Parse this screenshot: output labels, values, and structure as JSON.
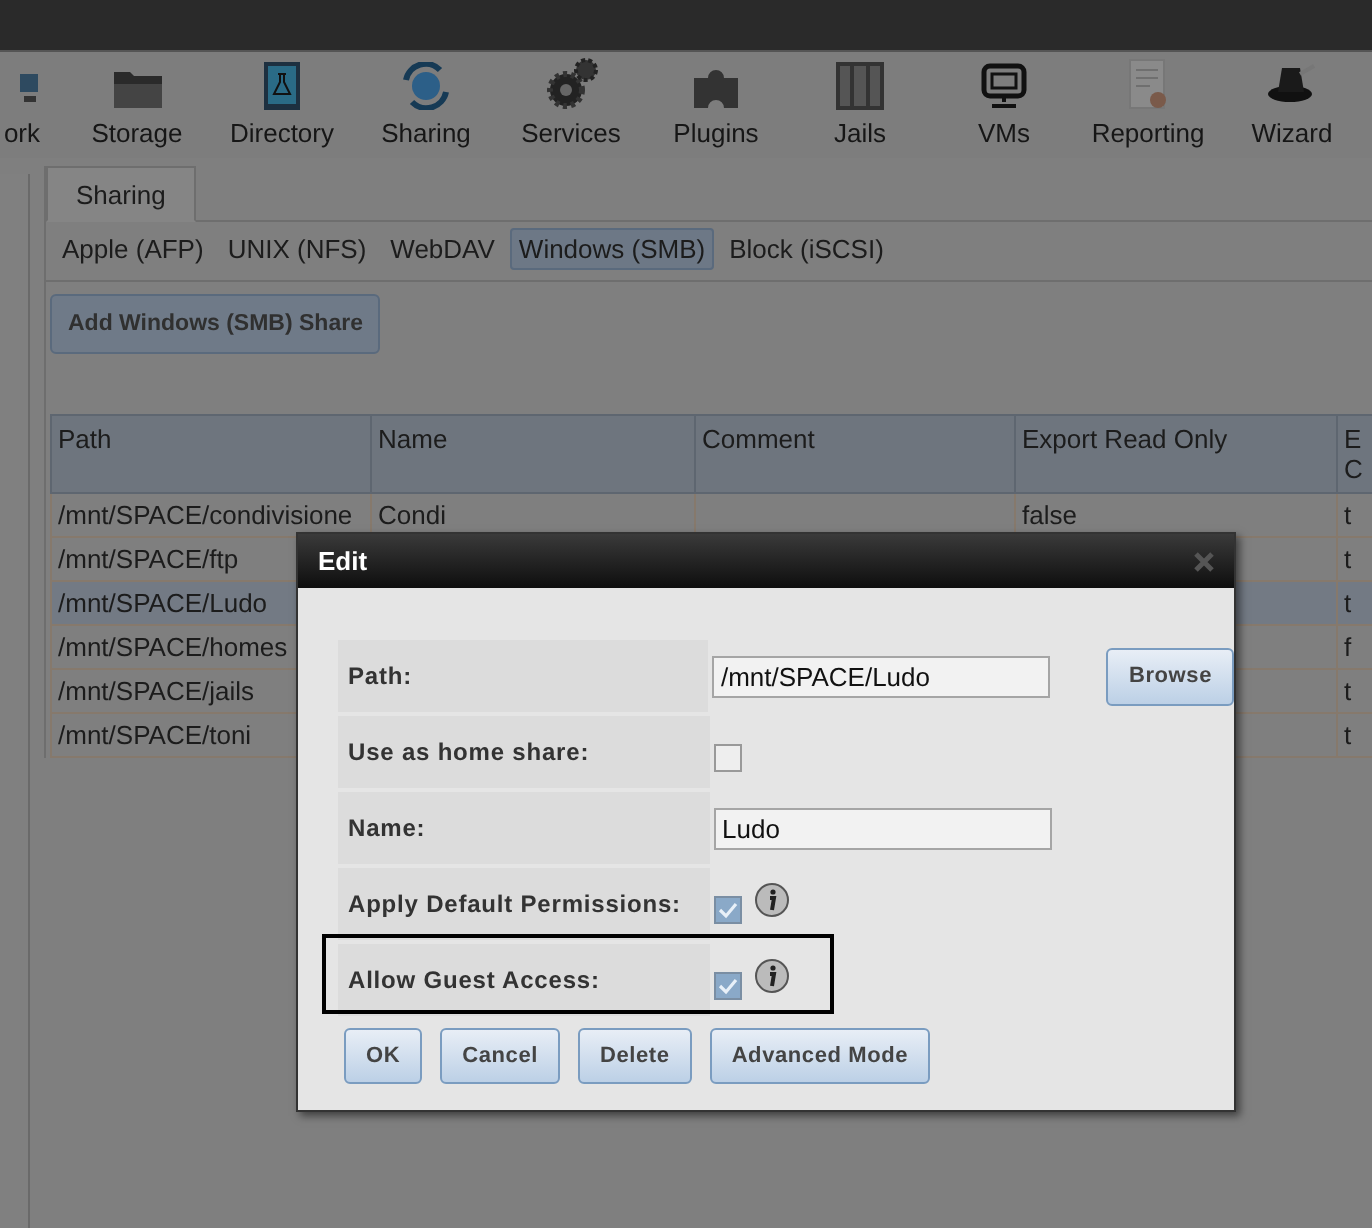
{
  "nav": [
    {
      "label": "ork",
      "kind": "network"
    },
    {
      "label": "Storage",
      "kind": "folder"
    },
    {
      "label": "Directory",
      "kind": "book"
    },
    {
      "label": "Sharing",
      "kind": "globe"
    },
    {
      "label": "Services",
      "kind": "gears"
    },
    {
      "label": "Plugins",
      "kind": "puzzle"
    },
    {
      "label": "Jails",
      "kind": "bars"
    },
    {
      "label": "VMs",
      "kind": "monitor"
    },
    {
      "label": "Reporting",
      "kind": "report"
    },
    {
      "label": "Wizard",
      "kind": "hat"
    }
  ],
  "page_tabs": [
    {
      "label": "Sharing",
      "selected": true
    }
  ],
  "share_types": [
    {
      "label": "Apple (AFP)",
      "selected": false
    },
    {
      "label": "UNIX (NFS)",
      "selected": false
    },
    {
      "label": "WebDAV",
      "selected": false
    },
    {
      "label": "Windows (SMB)",
      "selected": true
    },
    {
      "label": "Block (iSCSI)",
      "selected": false
    }
  ],
  "add_button": "Add Windows (SMB) Share",
  "table": {
    "columns": [
      "Path",
      "Name",
      "Comment",
      "Export Read Only",
      "E\nC"
    ],
    "rows": [
      {
        "cells": [
          "/mnt/SPACE/condivisione",
          "Condi",
          null,
          "false",
          "t"
        ],
        "selected": false
      },
      {
        "cells": [
          "/mnt/SPACE/ftp",
          null,
          null,
          null,
          "t"
        ],
        "selected": false
      },
      {
        "cells": [
          "/mnt/SPACE/Ludo",
          null,
          null,
          null,
          "t"
        ],
        "selected": true
      },
      {
        "cells": [
          "/mnt/SPACE/homes",
          null,
          null,
          null,
          "f"
        ],
        "selected": false
      },
      {
        "cells": [
          "/mnt/SPACE/jails",
          null,
          null,
          null,
          "t"
        ],
        "selected": false
      },
      {
        "cells": [
          "/mnt/SPACE/toni",
          null,
          null,
          null,
          "t"
        ],
        "selected": false
      }
    ]
  },
  "dialog": {
    "title": "Edit",
    "fields": [
      {
        "kind": "text",
        "label": "Path:",
        "value": "/mnt/SPACE/Ludo",
        "button": "Browse",
        "highlighted": false
      },
      {
        "kind": "checkbox",
        "label": "Use as home share:",
        "checked": false,
        "info": false,
        "highlighted": false
      },
      {
        "kind": "text",
        "label": "Name:",
        "value": "Ludo",
        "highlighted": false
      },
      {
        "kind": "checkbox",
        "label": "Apply Default Permissions:",
        "checked": true,
        "info": true,
        "highlighted": false
      },
      {
        "kind": "checkbox",
        "label": "Allow Guest Access:",
        "checked": true,
        "info": true,
        "highlighted": true
      }
    ],
    "buttons": [
      "OK",
      "Cancel",
      "Delete",
      "Advanced Mode"
    ]
  }
}
